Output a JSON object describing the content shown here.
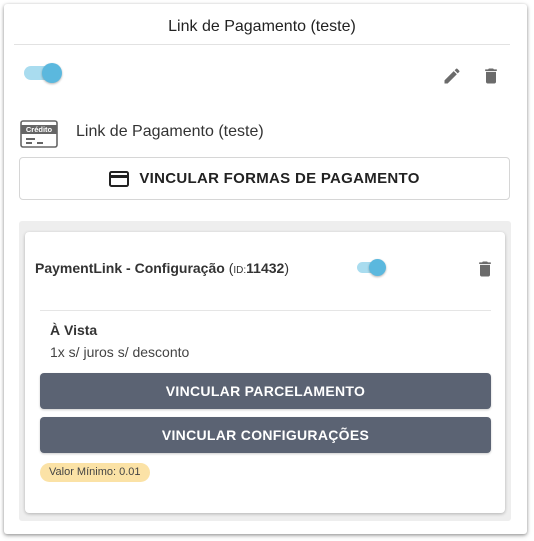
{
  "header": {
    "title": "Link de Pagamento (teste)"
  },
  "status_toggle": {
    "checked": true
  },
  "payment_method": {
    "icon_text": "Crédito",
    "label": "Link de Pagamento (teste)"
  },
  "link_button": {
    "label": "VINCULAR FORMAS DE PAGAMENTO"
  },
  "config": {
    "title": "PaymentLink - Configuração",
    "id_open": "(",
    "id_prefix": "ID:",
    "id_value": "11432",
    "id_close": ")",
    "toggle_checked": true,
    "plan_name": "À Vista",
    "plan_desc": "1x s/ juros s/ desconto",
    "btn_parcelamento": "VINCULAR PARCELAMENTO",
    "btn_configuracoes": "VINCULAR CONFIGURAÇÕES",
    "min_value_badge": "Valor Mínimo: 0.01"
  },
  "icons": [
    "pencil-icon",
    "trash-icon",
    "credit-card-icon",
    "trash-icon"
  ],
  "colors": {
    "toggle_on": "#5bb8de",
    "toggle_track": "#a9dcef",
    "dark_button": "#5b6373",
    "badge_bg": "#fbe2a6"
  }
}
